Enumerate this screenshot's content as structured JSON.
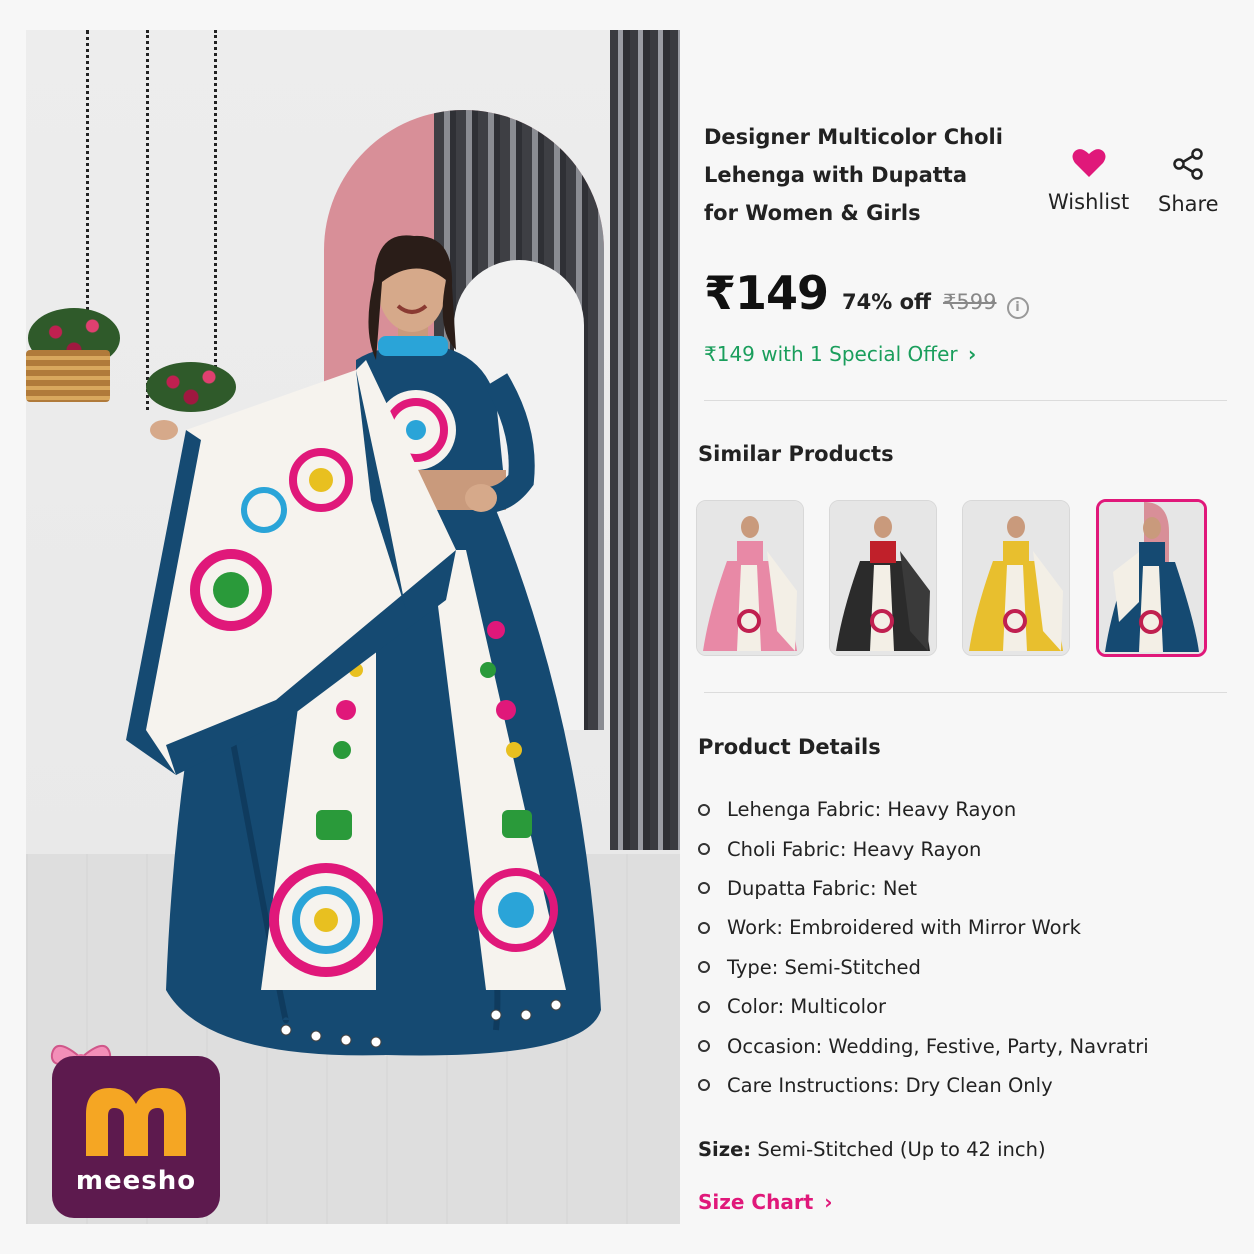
{
  "product": {
    "title_lines": [
      "Designer Multicolor Choli",
      "Lehenga with Dupatta",
      "for Women & Girls"
    ],
    "price": "₹149",
    "discount": "74% off",
    "mrp": "₹599",
    "offer_text": "₹149 with 1 Special Offer",
    "offer_chevron": "›"
  },
  "actions": {
    "wishlist_label": "Wishlist",
    "share_label": "Share",
    "wishlist_color": "#e0187a"
  },
  "similar": {
    "heading": "Similar Products",
    "items": [
      {
        "color": "pink",
        "selected": false
      },
      {
        "color": "black",
        "selected": false
      },
      {
        "color": "yellow",
        "selected": false
      },
      {
        "color": "blue",
        "selected": true
      }
    ]
  },
  "details": {
    "heading": "Product Details",
    "items": [
      "Lehenga Fabric: Heavy Rayon",
      "Choli Fabric: Heavy Rayon",
      "Dupatta Fabric: Net",
      "Work: Embroidered with Mirror Work",
      "Type: Semi-Stitched",
      "Color: Multicolor",
      "Occasion: Wedding, Festive, Party, Navratri",
      "Care Instructions: Dry Clean Only"
    ]
  },
  "size": {
    "label": "Size:",
    "value": "Semi-Stitched (Up to 42 inch)",
    "chart_link": "Size Chart",
    "chart_chevron": "›"
  },
  "brand": {
    "name": "meesho",
    "logo_bg": "#5d1a4e",
    "accent": "#e0187a"
  }
}
